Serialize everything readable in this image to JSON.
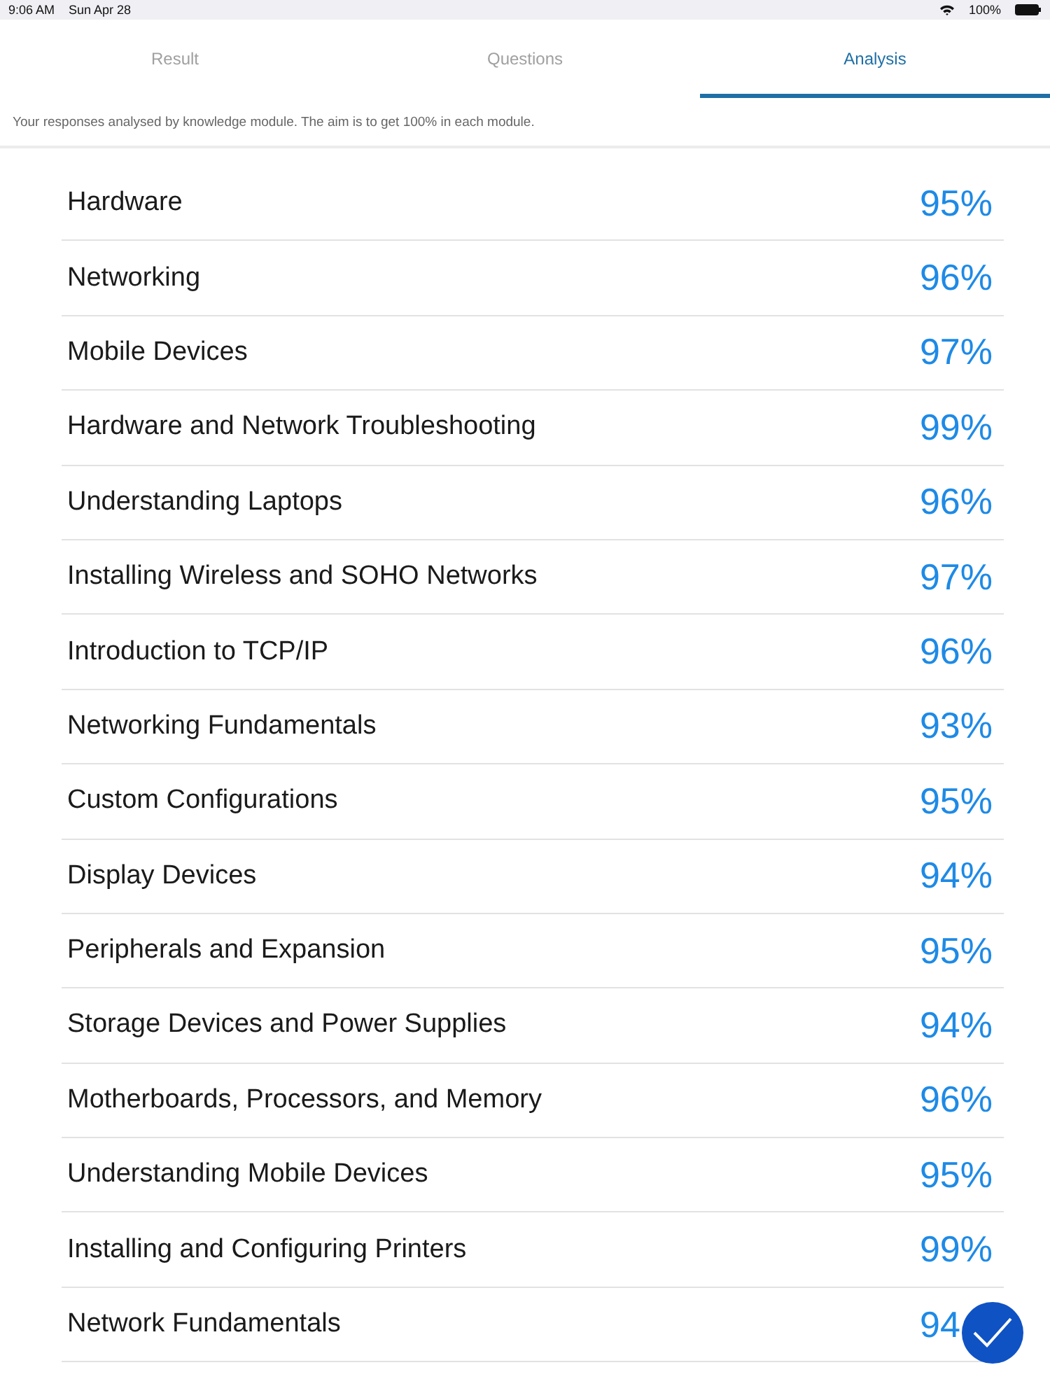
{
  "status_bar": {
    "time": "9:06 AM",
    "date": "Sun Apr 28",
    "battery": "100%"
  },
  "tabs": [
    {
      "label": "Result",
      "selected": false
    },
    {
      "label": "Questions",
      "selected": false
    },
    {
      "label": "Analysis",
      "selected": true
    }
  ],
  "description": "Your responses analysed by knowledge module. The aim is to get 100% in each module.",
  "modules": [
    {
      "name": "Hardware",
      "score": "95%"
    },
    {
      "name": "Networking",
      "score": "96%"
    },
    {
      "name": "Mobile Devices",
      "score": "97%"
    },
    {
      "name": "Hardware and Network Troubleshooting",
      "score": "99%"
    },
    {
      "name": "Understanding Laptops",
      "score": "96%"
    },
    {
      "name": "Installing Wireless and SOHO Networks",
      "score": "97%"
    },
    {
      "name": "Introduction to TCP/IP",
      "score": "96%"
    },
    {
      "name": "Networking Fundamentals",
      "score": "93%"
    },
    {
      "name": "Custom Configurations",
      "score": "95%"
    },
    {
      "name": "Display Devices",
      "score": "94%"
    },
    {
      "name": "Peripherals and Expansion",
      "score": "95%"
    },
    {
      "name": "Storage Devices and Power Supplies",
      "score": "94%"
    },
    {
      "name": "Motherboards, Processors, and Memory",
      "score": "96%"
    },
    {
      "name": "Understanding Mobile Devices",
      "score": "95%"
    },
    {
      "name": "Installing and Configuring Printers",
      "score": "99%"
    },
    {
      "name": "Network Fundamentals",
      "score": "94"
    }
  ]
}
